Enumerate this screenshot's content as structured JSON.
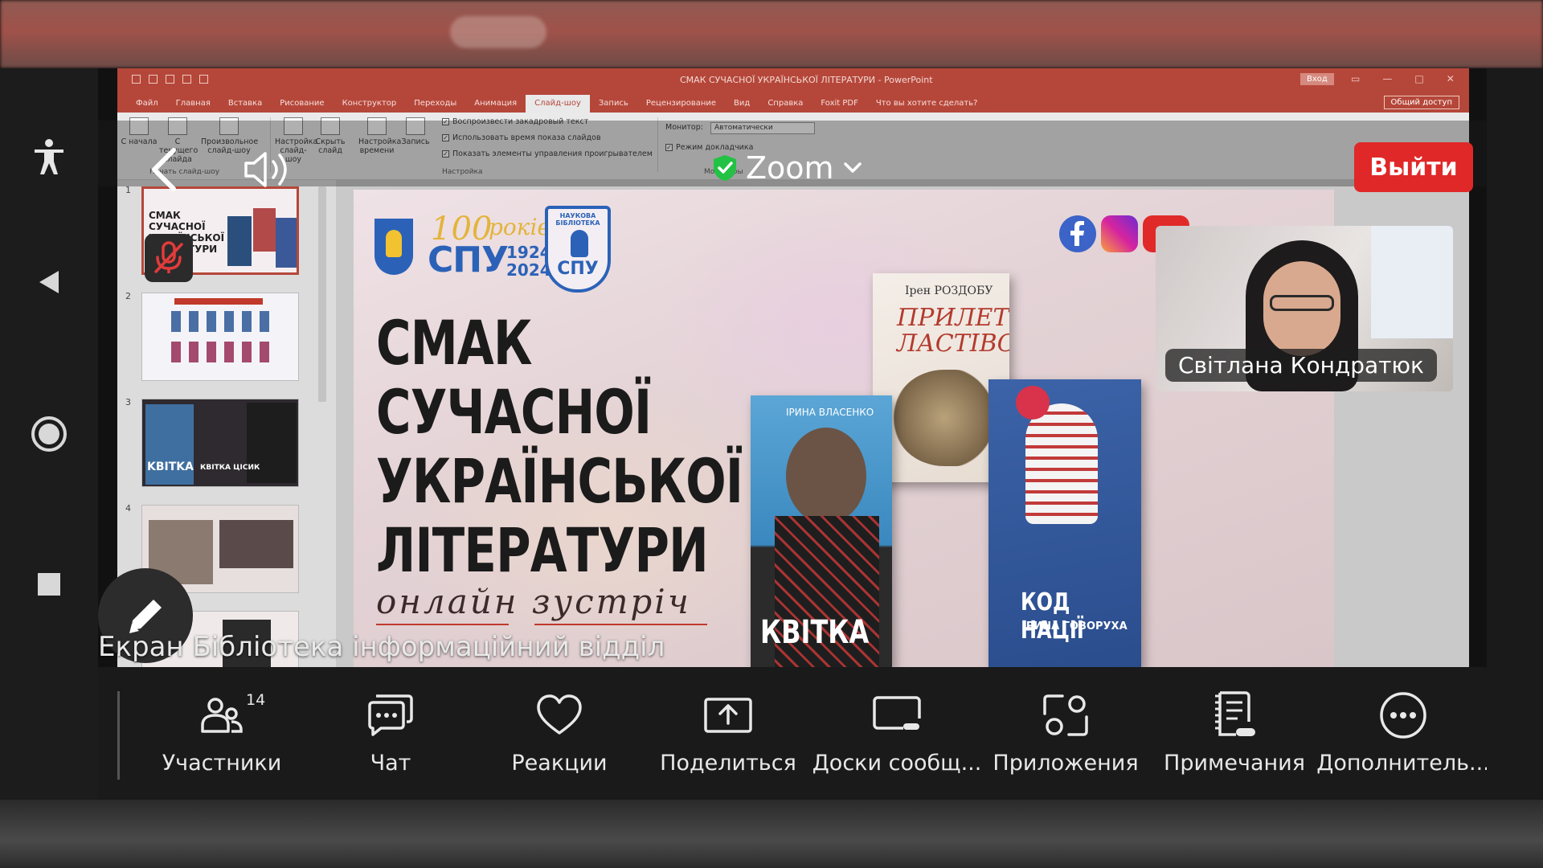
{
  "ppt": {
    "title": "СМАК СУЧАСНОЇ УКРАЇНСЬКОЇ ЛІТЕРАТУРИ - PowerPoint",
    "signin": "Вход",
    "share": "Общий доступ",
    "tabs": [
      "Файл",
      "Главная",
      "Вставка",
      "Рисование",
      "Конструктор",
      "Переходы",
      "Анимация",
      "Слайд-шоу",
      "Запись",
      "Рецензирование",
      "Вид",
      "Справка",
      "Foxit PDF",
      "Что вы хотите сделать?"
    ],
    "active_tab": "Слайд-шоу",
    "ribbon": {
      "from_start": "С начала",
      "from_current": "С текущего слайда",
      "custom": "Произвольное слайд-шоу",
      "setup": "Настройка слайд-шоу",
      "hide": "Скрыть слайд",
      "timing": "Настройка времени",
      "record": "Запись",
      "group_start": "Начать слайд-шоу",
      "group_setup": "Настройка",
      "check1": "Воспроизвести закадровый текст",
      "check2": "Использовать время показа слайдов",
      "check3": "Показать элементы управления проигрывателем",
      "monitor_label": "Монитор:",
      "monitor_value": "Автоматически",
      "presenter": "Режим докладчика",
      "group_monitor": "Мониторы"
    },
    "thumb_numbers": [
      "1",
      "2",
      "3",
      "4",
      "5"
    ],
    "thumb1_text": "СМАК СУЧАСНОЇ УКРАЇНСЬКОЇ ЛІТЕРАТУРИ",
    "thumb3_label1": "KBITKA",
    "thumb3_label2": "КВІТКА ЦІСИК"
  },
  "slide": {
    "title_lines": [
      "СМАК СУЧАСНОЇ",
      "УКРАЇНСЬКОЇ",
      "ЛІТЕРАТУРИ"
    ],
    "subtitle": "онлайн зустріч",
    "logo_100": "100",
    "logo_rokiv": "років",
    "logo_spu": "СПУ",
    "logo_years_1": "1924",
    "logo_years_2": "2024",
    "lib_top": "НАУКОВА БІБЛІОТЕКА",
    "lib_spu": "СПУ",
    "book1_author": "ІРИНА ВЛАСЕНКО",
    "book1_title": "КВІТКА",
    "book2_author": "Ірен РОЗДОБУ",
    "book2_title": "ПРИЛЕТ ЛАСТІВО",
    "book3_title": "КОД НАЦІЇ",
    "book3_author": "ІРИНА ГОВОРУХА"
  },
  "zoom": {
    "app_title": "Zoom",
    "leave": "Выйти",
    "participant_name": "Світлана Кондратюк",
    "screen_label": "Екран Бібліотека інформаційний відділ",
    "participants_count": "14",
    "toolbar": [
      {
        "label": "Участники",
        "icon": "participants-icon"
      },
      {
        "label": "Чат",
        "icon": "chat-icon"
      },
      {
        "label": "Реакции",
        "icon": "heart-icon"
      },
      {
        "label": "Поделиться",
        "icon": "share-icon"
      },
      {
        "label": "Доски сообщ...",
        "icon": "whiteboard-icon"
      },
      {
        "label": "Приложения",
        "icon": "apps-icon"
      },
      {
        "label": "Примечания",
        "icon": "notes-icon"
      },
      {
        "label": "Дополнитель...",
        "icon": "more-icon"
      }
    ]
  },
  "colors": {
    "ppt_accent": "#b5473a",
    "leave_red": "#e02828",
    "spu_blue": "#2b62b8",
    "spu_gold": "#e3b43a"
  }
}
